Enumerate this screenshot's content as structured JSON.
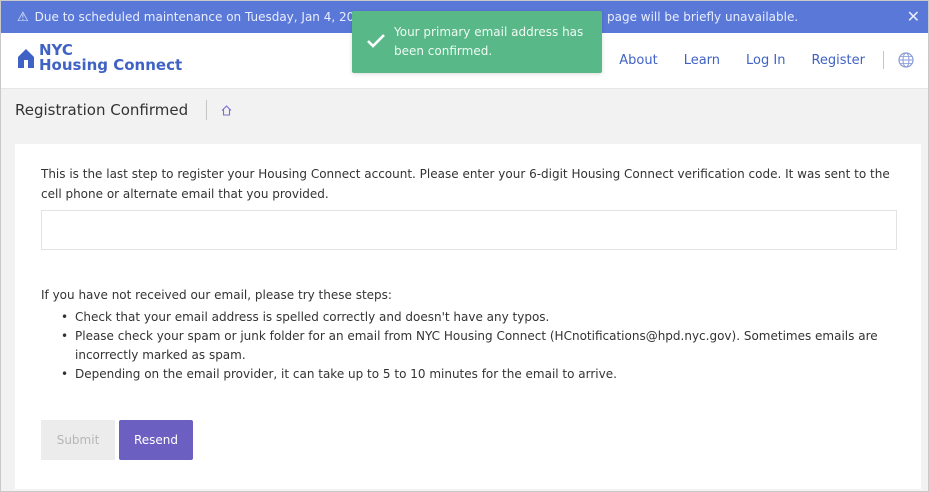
{
  "banner": {
    "text": "Due to scheduled maintenance on Tuesday, Jan 4, 20",
    "text_tail": "page will be briefly unavailable.",
    "close_glyph": "✕",
    "warning_icon": "warning-icon"
  },
  "toast": {
    "message": "Your primary email address has been confirmed.",
    "icon": "checkmark-icon"
  },
  "header": {
    "logo_line1": "NYC",
    "logo_line2": "Housing Connect",
    "nav": [
      "About",
      "Learn",
      "Log In",
      "Register"
    ],
    "globe_icon": "globe-icon"
  },
  "page": {
    "title": "Registration Confirmed",
    "home_icon": "home-icon"
  },
  "form": {
    "intro": "This is the last step to register your Housing Connect account. Please enter your 6-digit Housing Connect verification code. It was sent to the cell phone or alternate email that you provided.",
    "code_value": "",
    "steps_heading": "If you have not received our email, please try these steps:",
    "steps": [
      "Check that your email address is spelled correctly and doesn't have any typos.",
      "Please check your spam or junk folder for an email from NYC Housing Connect (HCnotifications@hpd.nyc.gov). Sometimes emails are incorrectly marked as spam.",
      "Depending on the email provider, it can take up to 5 to 10 minutes for the email to arrive."
    ],
    "submit_label": "Submit",
    "resend_label": "Resend"
  },
  "colors": {
    "banner": "#5a78d8",
    "toast": "#58b888",
    "brand": "#3f62c4",
    "resend": "#6b5fc2"
  }
}
